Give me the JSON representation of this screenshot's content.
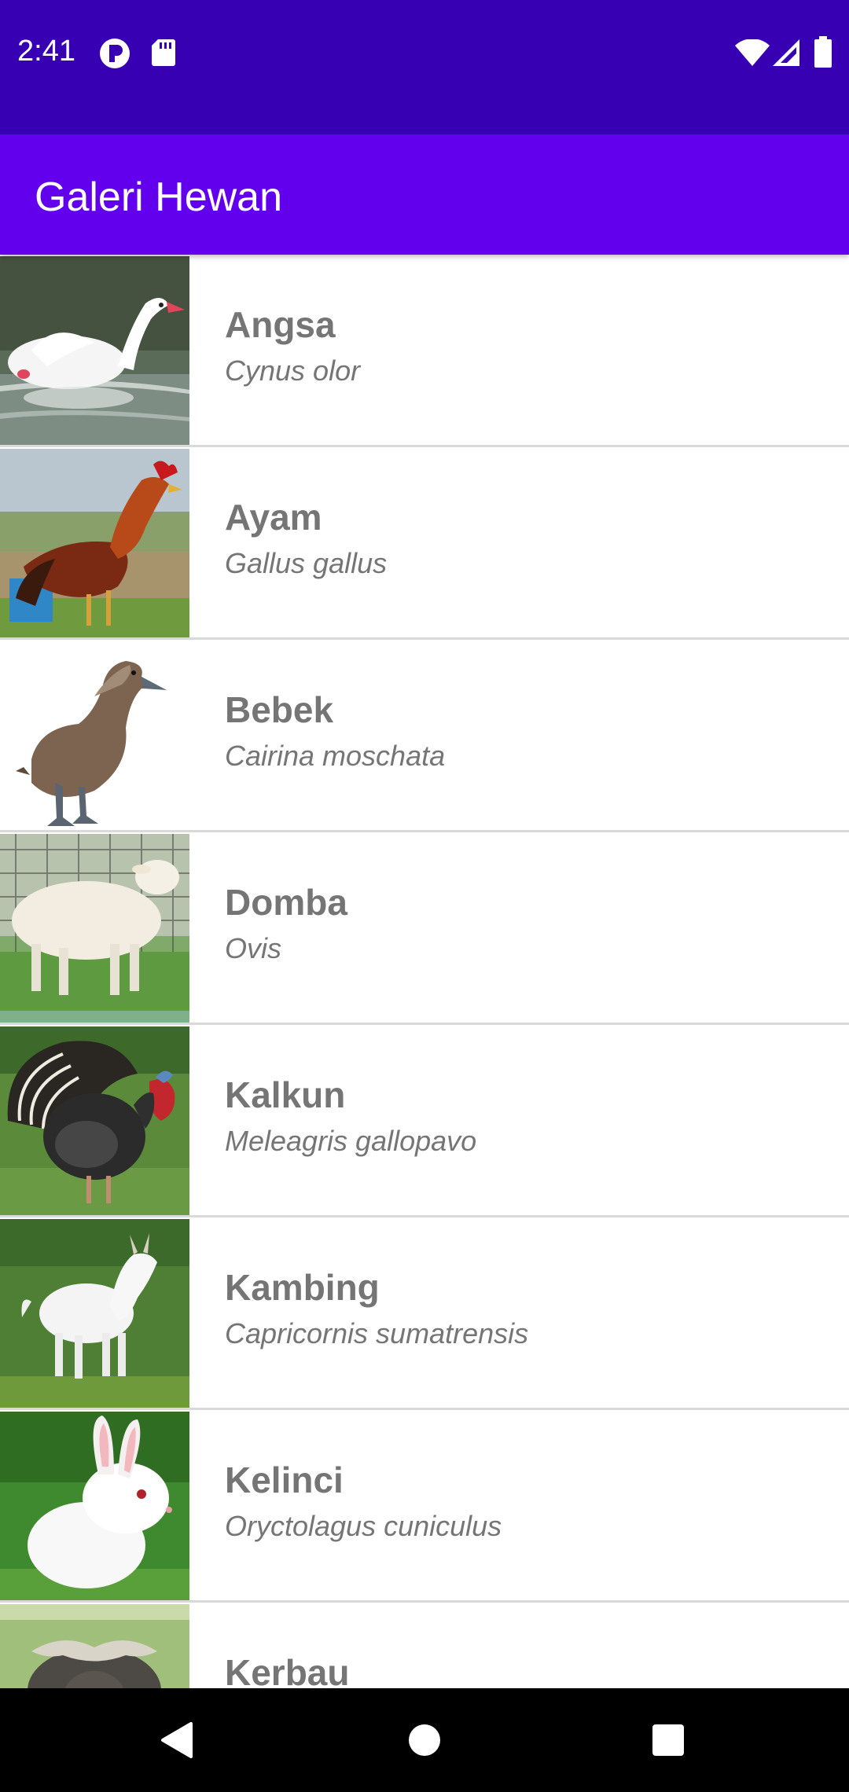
{
  "status_bar": {
    "time": "2:41",
    "background": "#3700b3",
    "left_icons": [
      "notification-p-icon",
      "sd-card-icon"
    ],
    "right_icons": [
      "wifi-icon",
      "cell-signal-icon",
      "battery-icon"
    ]
  },
  "app_bar": {
    "title": "Galeri Hewan",
    "background": "#6200ee"
  },
  "animals": [
    {
      "name": "Angsa",
      "latin": "Cynus olor",
      "image": "swan-photo"
    },
    {
      "name": "Ayam",
      "latin": "Gallus gallus",
      "image": "rooster-photo"
    },
    {
      "name": "Bebek",
      "latin": "Cairina moschata",
      "image": "duck-photo"
    },
    {
      "name": "Domba",
      "latin": "Ovis",
      "image": "sheep-photo"
    },
    {
      "name": "Kalkun",
      "latin": "Meleagris gallopavo",
      "image": "turkey-photo"
    },
    {
      "name": "Kambing",
      "latin": "Capricornis sumatrensis",
      "image": "goat-photo"
    },
    {
      "name": "Kelinci",
      "latin": "Oryctolagus cuniculus",
      "image": "rabbit-photo"
    },
    {
      "name": "Kerbau",
      "latin": "",
      "image": "buffalo-photo"
    }
  ],
  "nav_bar": {
    "buttons": [
      "back-icon",
      "home-icon",
      "recents-icon"
    ]
  }
}
